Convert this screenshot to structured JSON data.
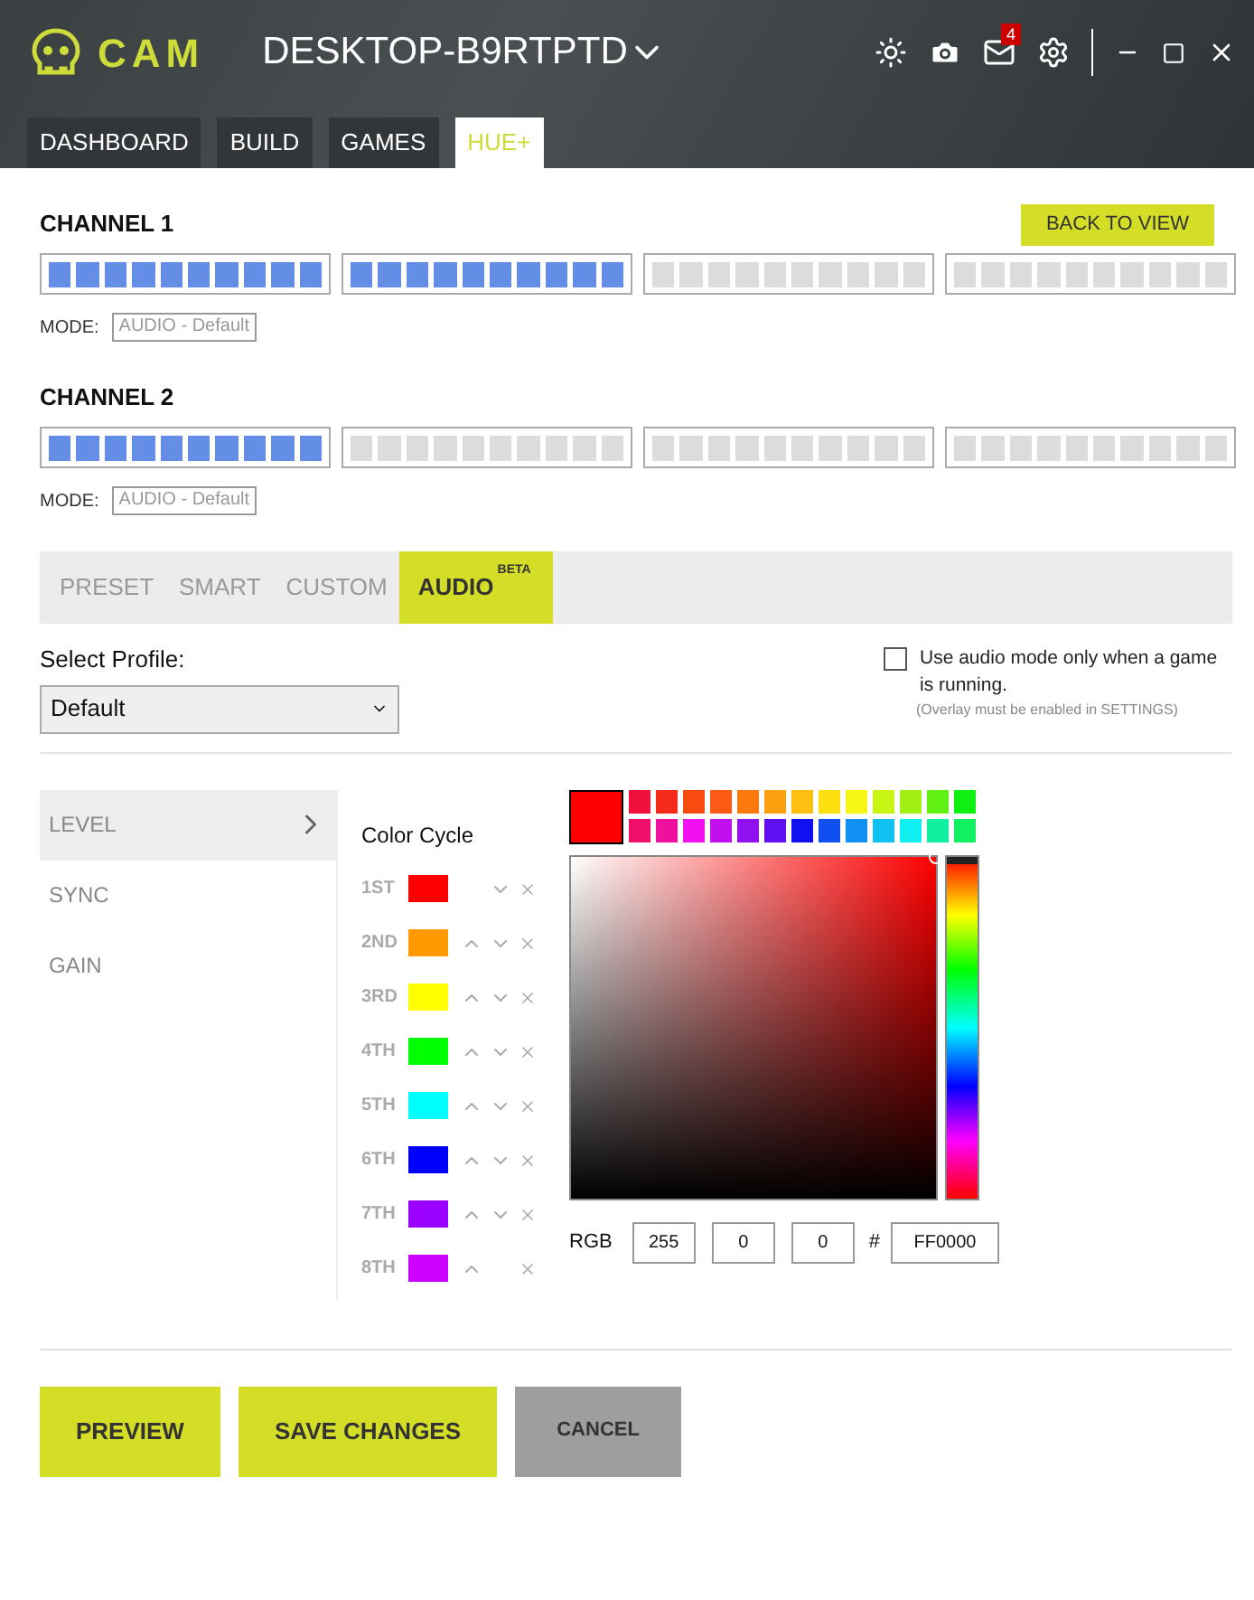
{
  "header": {
    "logo": "CAM",
    "device": "DESKTOP-B9RTPTD",
    "mail_count": "4"
  },
  "nav_tabs": [
    {
      "label": "DASHBOARD",
      "selected": false
    },
    {
      "label": "BUILD",
      "selected": false
    },
    {
      "label": "GAMES",
      "selected": false
    },
    {
      "label": "HUE+",
      "selected": true
    }
  ],
  "back_button": "BACK TO VIEW",
  "channels": [
    {
      "title": "CHANNEL 1",
      "segments": [
        {
          "lit": true
        },
        {
          "lit": true
        },
        {
          "lit": false
        },
        {
          "lit": false
        }
      ],
      "mode_label": "MODE:",
      "mode": "AUDIO - Default"
    },
    {
      "title": "CHANNEL 2",
      "segments": [
        {
          "lit": true
        },
        {
          "lit": false
        },
        {
          "lit": false
        },
        {
          "lit": false
        }
      ],
      "mode_label": "MODE:",
      "mode": "AUDIO - Default"
    }
  ],
  "mode_tabs": [
    {
      "label": "PRESET",
      "selected": false
    },
    {
      "label": "SMART",
      "selected": false
    },
    {
      "label": "CUSTOM",
      "selected": false
    },
    {
      "label": "AUDIO",
      "badge": "BETA",
      "selected": true
    }
  ],
  "profile": {
    "label": "Select Profile:",
    "value": "Default"
  },
  "game_only": {
    "checked": false,
    "label": "Use audio mode only when a game is running.",
    "note": "(Overlay must be enabled in SETTINGS)"
  },
  "side_menu": [
    {
      "label": "LEVEL",
      "selected": true
    },
    {
      "label": "SYNC",
      "selected": false
    },
    {
      "label": "GAIN",
      "selected": false
    }
  ],
  "color_cycle": {
    "title": "Color Cycle",
    "items": [
      {
        "label": "1ST",
        "color": "#ff0000",
        "up": false,
        "down": true
      },
      {
        "label": "2ND",
        "color": "#ff9900",
        "up": true,
        "down": true
      },
      {
        "label": "3RD",
        "color": "#ffff00",
        "up": true,
        "down": true
      },
      {
        "label": "4TH",
        "color": "#00ff00",
        "up": true,
        "down": true
      },
      {
        "label": "5TH",
        "color": "#00ffff",
        "up": true,
        "down": true
      },
      {
        "label": "6TH",
        "color": "#0000ff",
        "up": true,
        "down": true
      },
      {
        "label": "7TH",
        "color": "#9900ff",
        "up": true,
        "down": true
      },
      {
        "label": "8TH",
        "color": "#cc00ff",
        "up": true,
        "down": false
      }
    ]
  },
  "picker": {
    "hue": {
      "level": 0
    },
    "swatches": [
      {
        "color": "#f0103c"
      },
      {
        "color": "#f52a1a"
      },
      {
        "color": "#f94a10"
      },
      {
        "color": "#fb5a14"
      },
      {
        "color": "#fb7a10"
      },
      {
        "color": "#fca010"
      },
      {
        "color": "#fdc010"
      },
      {
        "color": "#fde010"
      },
      {
        "color": "#f6f514"
      },
      {
        "color": "#c8f514"
      },
      {
        "color": "#a0f014"
      },
      {
        "color": "#60f014"
      },
      {
        "color": "#10f010"
      },
      {
        "color": "#f0106a"
      },
      {
        "color": "#f010a0"
      },
      {
        "color": "#f010f0"
      },
      {
        "color": "#c010f0"
      },
      {
        "color": "#9010f0"
      },
      {
        "color": "#6010f0"
      },
      {
        "color": "#1010f0"
      },
      {
        "color": "#1050f0"
      },
      {
        "color": "#1090f0"
      },
      {
        "color": "#10c0f0"
      },
      {
        "color": "#10f0f0"
      },
      {
        "color": "#10f0a0"
      },
      {
        "color": "#10f060"
      }
    ],
    "rgb_label": "RGB",
    "r": "255",
    "g": "0",
    "b": "0",
    "hash": "#",
    "hex": "FF0000"
  },
  "footer_buttons": [
    {
      "label": "PREVIEW",
      "kind": "primary"
    },
    {
      "label": "SAVE CHANGES",
      "kind": "primary"
    },
    {
      "label": "CANCEL",
      "kind": "secondary"
    }
  ]
}
